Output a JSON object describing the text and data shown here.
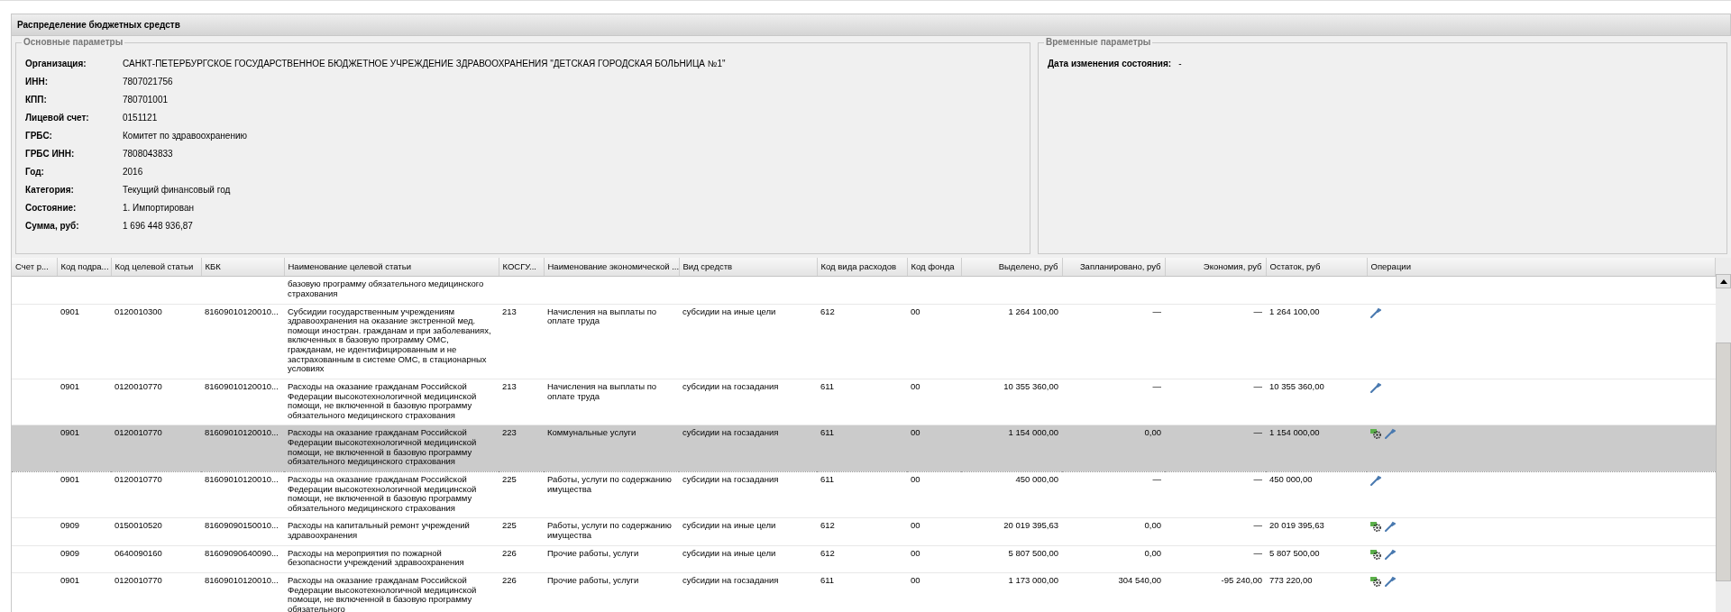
{
  "panel": {
    "title": "Распределение бюджетных средств"
  },
  "main_params": {
    "legend": "Основные параметры",
    "fields": [
      {
        "label": "Организация:",
        "value": "САНКТ-ПЕТЕРБУРГСКОЕ ГОСУДАРСТВЕННОЕ БЮДЖЕТНОЕ УЧРЕЖДЕНИЕ ЗДРАВООХРАНЕНИЯ \"ДЕТСКАЯ ГОРОДСКАЯ БОЛЬНИЦА №1\""
      },
      {
        "label": "ИНН:",
        "value": "7807021756"
      },
      {
        "label": "КПП:",
        "value": "780701001"
      },
      {
        "label": "Лицевой счет:",
        "value": "0151121"
      },
      {
        "label": "ГРБС:",
        "value": "Комитет по здравоохранению"
      },
      {
        "label": "ГРБС ИНН:",
        "value": "7808043833"
      },
      {
        "label": "Год:",
        "value": "2016"
      },
      {
        "label": "Категория:",
        "value": "Текущий финансовый год"
      },
      {
        "label": "Состояние:",
        "value": "1. Импортирован"
      },
      {
        "label": "Сумма, руб:",
        "value": "1 696 448 936,87"
      }
    ]
  },
  "time_params": {
    "legend": "Временные параметры",
    "fields": [
      {
        "label": "Дата изменения состояния:",
        "value": "-"
      }
    ]
  },
  "table": {
    "columns": [
      "Счет р...",
      "Код подра...",
      "Код целевой статьи",
      "КБК",
      "Наименование целевой статьи",
      "КОСГУ...",
      "Наименование экономической ...",
      "Вид средств",
      "Код вида расходов",
      "Код фонда",
      "Выделено, руб",
      "Запланировано, руб",
      "Экономия, руб",
      "Остаток, руб",
      "Операции"
    ],
    "rows": [
      {
        "selected": false,
        "cells": [
          null,
          null,
          null,
          null,
          "базовую программу обязательного медицинского страхования",
          null,
          null,
          null,
          null,
          null,
          null,
          null,
          null,
          null
        ],
        "operations": []
      },
      {
        "selected": false,
        "cells": [
          null,
          "0901",
          "0120010300",
          "81609010120010...",
          "Субсидии государственным учреждениям здравоохранения на оказание экстренной мед. помощи иностран. гражданам и при заболеваниях, включенных в базовую программу ОМС, гражданам, не идентифицированным и не застрахованным в системе ОМС, в стационарных условиях",
          "213",
          "Начисления на выплаты по оплате труда",
          "субсидии на иные цели",
          "612",
          "00",
          "1 264 100,00",
          "—",
          "—",
          "1 264 100,00"
        ],
        "operations": [
          {
            "kind": "edit"
          }
        ]
      },
      {
        "selected": false,
        "cells": [
          null,
          "0901",
          "0120010770",
          "81609010120010...",
          "Расходы на оказание гражданам Российской Федерации высокотехнологичной медицинской помощи, не включенной в базовую программу обязательного медицинского страхования",
          "213",
          "Начисления на выплаты по оплате труда",
          "субсидии на госзадания",
          "611",
          "00",
          "10 355 360,00",
          "—",
          "—",
          "10 355 360,00"
        ],
        "operations": [
          {
            "kind": "edit"
          }
        ]
      },
      {
        "selected": true,
        "cells": [
          null,
          "0901",
          "0120010770",
          "81609010120010...",
          "Расходы на оказание гражданам Российской Федерации высокотехнологичной медицинской помощи, не включенной в базовую программу обязательного медицинского страхования",
          "223",
          "Коммунальные услуги",
          "субсидии на госзадания",
          "611",
          "00",
          "1 154 000,00",
          "0,00",
          "—",
          "1 154 000,00"
        ],
        "operations": [
          {
            "kind": "plan"
          },
          {
            "kind": "edit"
          }
        ]
      },
      {
        "selected": false,
        "cells": [
          null,
          "0901",
          "0120010770",
          "81609010120010...",
          "Расходы на оказание гражданам Российской Федерации высокотехнологичной медицинской помощи, не включенной в базовую программу обязательного медицинского страхования",
          "225",
          "Работы, услуги по содержанию имущества",
          "субсидии на госзадания",
          "611",
          "00",
          "450 000,00",
          "—",
          "—",
          "450 000,00"
        ],
        "operations": [
          {
            "kind": "edit"
          }
        ]
      },
      {
        "selected": false,
        "cells": [
          null,
          "0909",
          "0150010520",
          "81609090150010...",
          "Расходы на капитальный ремонт учреждений здравоохранения",
          "225",
          "Работы, услуги по содержанию имущества",
          "субсидии на иные цели",
          "612",
          "00",
          "20 019 395,63",
          "0,00",
          "—",
          "20 019 395,63"
        ],
        "operations": [
          {
            "kind": "plan"
          },
          {
            "kind": "edit"
          }
        ]
      },
      {
        "selected": false,
        "cells": [
          null,
          "0909",
          "0640090160",
          "81609090640090...",
          "Расходы на мероприятия по пожарной безопасности учреждений здравоохранения",
          "226",
          "Прочие работы, услуги",
          "субсидии на иные цели",
          "612",
          "00",
          "5 807 500,00",
          "0,00",
          "—",
          "5 807 500,00"
        ],
        "operations": [
          {
            "kind": "plan"
          },
          {
            "kind": "edit"
          }
        ]
      },
      {
        "selected": false,
        "cells": [
          null,
          "0901",
          "0120010770",
          "81609010120010...",
          "Расходы на оказание гражданам Российской Федерации высокотехнологичной медицинской помощи, не включенной в базовую программу обязательного",
          "226",
          "Прочие работы, услуги",
          "субсидии на госзадания",
          "611",
          "00",
          "1 173 000,00",
          "304 540,00",
          "-95 240,00",
          "773 220,00"
        ],
        "operations": [
          {
            "kind": "plan"
          },
          {
            "kind": "edit"
          }
        ]
      }
    ]
  }
}
